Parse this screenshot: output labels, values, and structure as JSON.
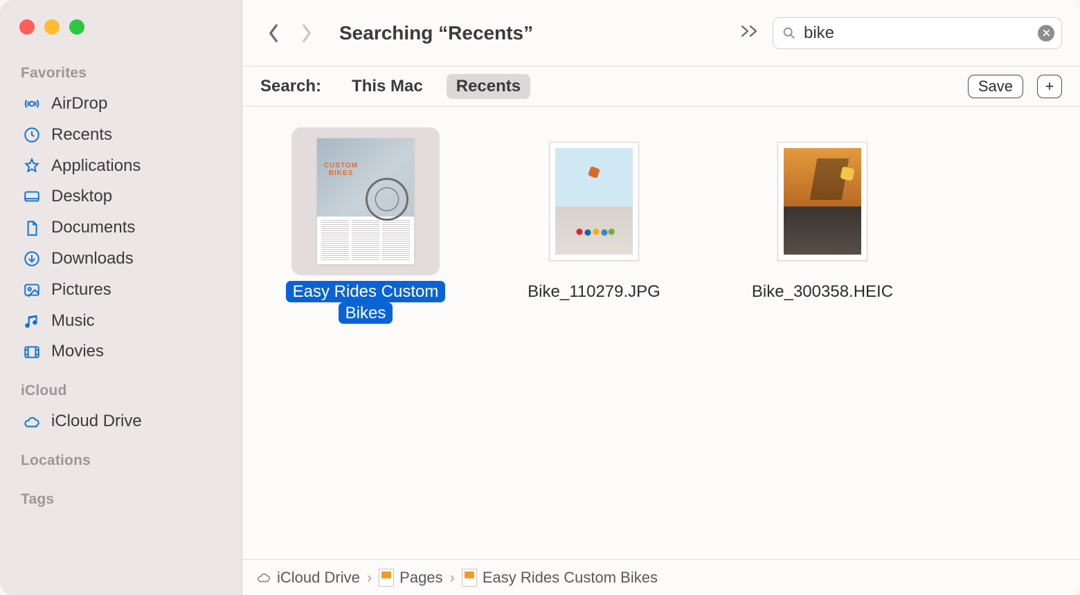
{
  "sidebar": {
    "sections": {
      "favorites_title": "Favorites",
      "icloud_title": "iCloud",
      "locations_title": "Locations",
      "tags_title": "Tags"
    },
    "favorites": [
      {
        "id": "airdrop",
        "label": "AirDrop"
      },
      {
        "id": "recents",
        "label": "Recents"
      },
      {
        "id": "applications",
        "label": "Applications"
      },
      {
        "id": "desktop",
        "label": "Desktop"
      },
      {
        "id": "documents",
        "label": "Documents"
      },
      {
        "id": "downloads",
        "label": "Downloads"
      },
      {
        "id": "pictures",
        "label": "Pictures"
      },
      {
        "id": "music",
        "label": "Music"
      },
      {
        "id": "movies",
        "label": "Movies"
      }
    ],
    "icloud": [
      {
        "id": "icloud-drive",
        "label": "iCloud Drive"
      }
    ]
  },
  "toolbar": {
    "title": "Searching “Recents”",
    "search_value": "bike"
  },
  "scopebar": {
    "label": "Search:",
    "options": [
      {
        "id": "this-mac",
        "label": "This Mac",
        "active": false
      },
      {
        "id": "recents",
        "label": "Recents",
        "active": true
      }
    ],
    "save_label": "Save",
    "plus_label": "+"
  },
  "results": [
    {
      "id": "easy-rides",
      "label": "Easy Rides Custom Bikes",
      "selected": true,
      "kind": "doc"
    },
    {
      "id": "bike-1",
      "label": "Bike_110279.JPG",
      "selected": false,
      "kind": "photo-a"
    },
    {
      "id": "bike-2",
      "label": "Bike_300358.HEIC",
      "selected": false,
      "kind": "photo-b"
    }
  ],
  "pathbar": {
    "segments": [
      {
        "id": "icloud-drive",
        "label": "iCloud Drive"
      },
      {
        "id": "pages",
        "label": "Pages"
      },
      {
        "id": "file",
        "label": "Easy Rides Custom Bikes"
      }
    ]
  },
  "doc_thumb": {
    "title_line1": "CUSTOM",
    "title_line2": "BIKES"
  }
}
